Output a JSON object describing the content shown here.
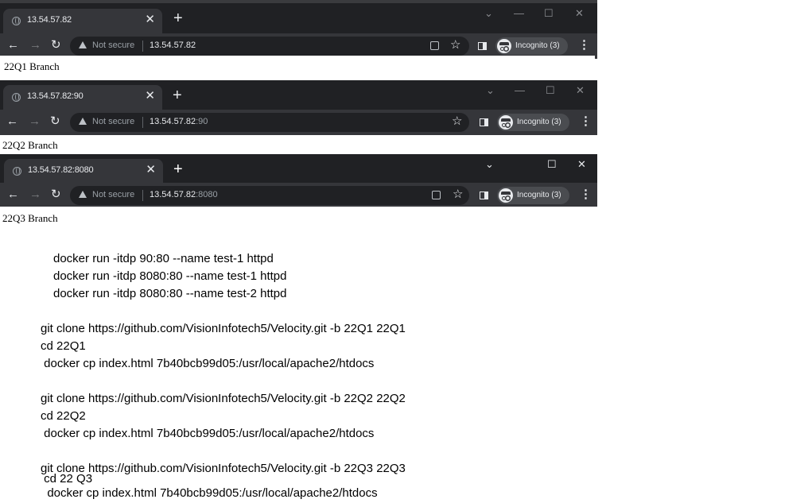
{
  "windows": [
    {
      "tab_title": "13.54.57.82",
      "url_host": "13.54.57.82",
      "url_port": "",
      "not_secure": "Not secure",
      "incognito": "Incognito (3)",
      "page_text": "22Q1 Branch",
      "controls": {
        "dropdown": "⌄",
        "minimize": "—",
        "maximize": "☐",
        "close": "✕"
      }
    },
    {
      "tab_title": "13.54.57.82:90",
      "url_host": "13.54.57.82",
      "url_port": ":90",
      "not_secure": "Not secure",
      "incognito": "Incognito (3)",
      "page_text": "22Q2 Branch",
      "controls": {
        "dropdown": "⌄",
        "minimize": "—",
        "maximize": "☐",
        "close": "✕"
      }
    },
    {
      "tab_title": "13.54.57.82:8080",
      "url_host": "13.54.57.82",
      "url_port": ":8080",
      "not_secure": "Not secure",
      "incognito": "Incognito (3)",
      "page_text": "22Q3 Branch",
      "controls": {
        "dropdown": "⌄",
        "minimize": "",
        "maximize": "☐",
        "close": "✕"
      }
    }
  ],
  "browser_glyphs": {
    "back": "←",
    "forward": "→",
    "reload": "↻",
    "star": "☆",
    "menu": "⋮",
    "new_tab": "+",
    "tab_close": "✕"
  },
  "notes": [
    "docker run -itdp 90:80 --name test-1 httpd",
    "docker run -itdp 8080:80 --name test-1 httpd",
    "docker run -itdp 8080:80 --name test-2 httpd",
    "git clone https://github.com/VisionInfotech5/Velocity.git -b 22Q1 22Q1",
    "cd 22Q1",
    " docker cp index.html 7b40bcb99d05:/usr/local/apache2/htdocs",
    "git clone https://github.com/VisionInfotech5/Velocity.git -b 22Q2 22Q2",
    "cd 22Q2",
    " docker cp index.html 7b40bcb99d05:/usr/local/apache2/htdocs",
    "git clone https://github.com/VisionInfotech5/Velocity.git -b 22Q3 22Q3",
    " cd 22 Q3",
    "  docker cp index.html 7b40bcb99d05:/usr/local/apache2/htdocs"
  ],
  "colors": {
    "tabstrip": "#202124",
    "active_tab": "#35363a",
    "omnibox": "#202124",
    "text_light": "#e8eaed"
  }
}
